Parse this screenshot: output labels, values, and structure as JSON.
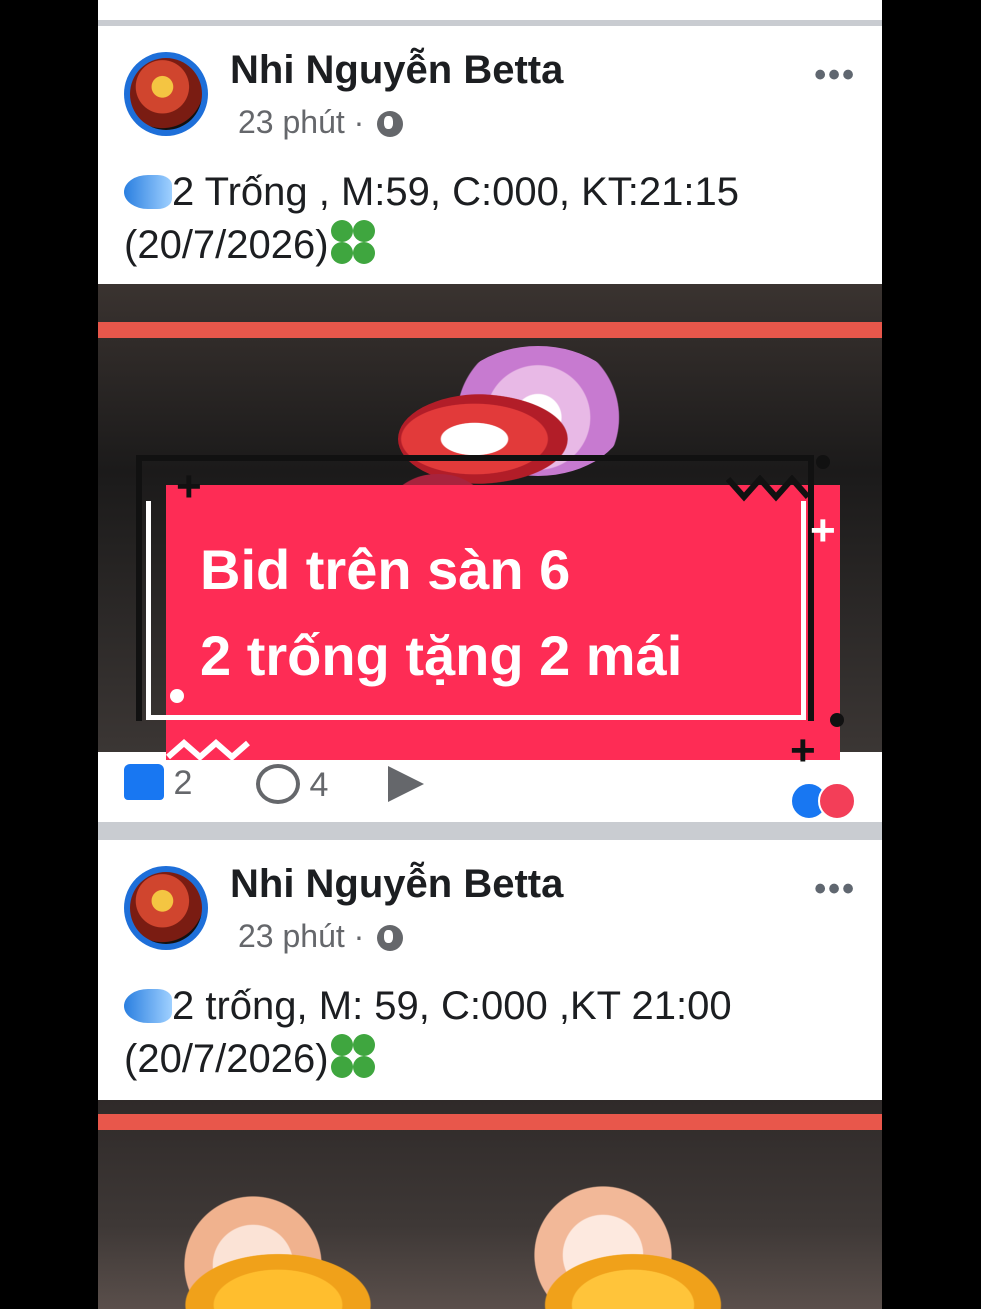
{
  "posts": [
    {
      "author": "Nhi Nguyễn Betta",
      "time": "23 phút",
      "separator": "·",
      "more": "•••",
      "text_line1": "2 Trống , M:59, C:000, KT:21:15",
      "text_line2": "(20/7/2026)",
      "likes": "2",
      "comments": "4"
    },
    {
      "author": "Nhi Nguyễn Betta",
      "time": "23 phút",
      "separator": "·",
      "more": "•••",
      "text_line1": "2 trống, M: 59,  C:000 ,KT 21:00",
      "text_line2": "(20/7/2026)"
    }
  ],
  "overlay": {
    "line1": "Bid trên sàn 6",
    "line2": "2 trống tặng 2 mái"
  },
  "icons": {
    "fish": "tropical-fish-emoji",
    "clover": "four-leaf-clover-emoji",
    "globe": "globe-icon",
    "like": "thumbs-up-icon",
    "comment": "comment-bubble-icon",
    "share": "share-arrow-icon"
  },
  "colors": {
    "accent": "#fe2c55",
    "facebook_blue": "#1877f2",
    "love": "#f33e58"
  }
}
